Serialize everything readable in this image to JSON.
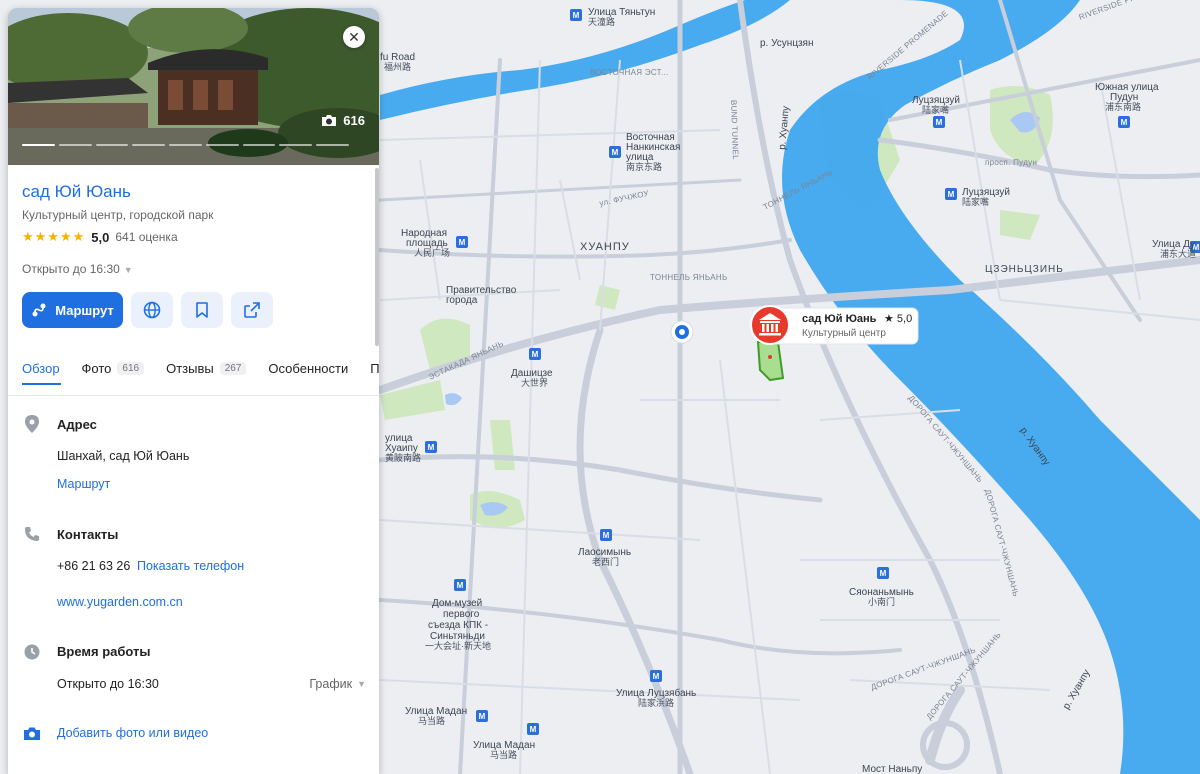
{
  "card": {
    "photo_count": "616",
    "title": "сад Юй Юань",
    "subtitle": "Культурный центр, городской парк",
    "stars": "★★★★★",
    "rating": "5,0",
    "rating_count": "641 оценка",
    "open_status": "Открыто до 16:30",
    "route_button": "Маршрут",
    "tabs": [
      {
        "label": "Обзор",
        "badge": ""
      },
      {
        "label": "Фото",
        "badge": "616"
      },
      {
        "label": "Отзывы",
        "badge": "267"
      },
      {
        "label": "Особенности",
        "badge": ""
      },
      {
        "label": "По",
        "badge": ""
      }
    ],
    "address_head": "Адрес",
    "address_value": "Шанхай, сад Юй Юань",
    "address_route_link": "Маршрут",
    "contacts_head": "Контакты",
    "phone_partial": "+86 21 63 26",
    "show_phone_link": "Показать телефон",
    "website": "www.yugarden.com.cn",
    "hours_head": "Время работы",
    "hours_value": "Открыто до 16:30",
    "schedule_link": "График",
    "add_photo_link": "Добавить фото или видео",
    "icons": [
      "camera-icon",
      "close-icon",
      "route-icon",
      "globe-icon",
      "bookmark-icon",
      "share-icon",
      "location-pin-icon",
      "phone-icon",
      "clock-icon",
      "camera-add-icon"
    ],
    "accent_color": "#1f6fe0"
  },
  "map": {
    "poi_popup": {
      "name": "сад Юй Юань",
      "rating": "★ 5,0",
      "category": "Культурный центр",
      "marker_color": "#e8392d"
    },
    "labels": {
      "tianton": "Улица Тяньтун",
      "tianton_cn": "天潼路",
      "fu_road": "fu Road",
      "fu_road_cn": "福州路",
      "east_nanking_1": "Восточная",
      "east_nanking_2": "Нанкинская",
      "east_nanking_3": "улица",
      "east_nanking_cn": "南京东路",
      "people_sq_1": "Народная",
      "people_sq_2": "площадь",
      "people_sq_cn": "人民广场",
      "gov_1": "Правительство",
      "gov_2": "города",
      "huangpu": "ХУАНПУ",
      "dashijie": "Дашицзе",
      "dashijie_cn": "大世界",
      "huaihai_1": "улица",
      "huaihai_2": "Хуаипу",
      "huaihai_cn": "黄陂南路",
      "laoximen": "Лаосимынь",
      "laoximen_cn": "老西门",
      "museum_1": "Дом-музей",
      "museum_2": "первого",
      "museum_3": "съезда КПК -",
      "museum_4": "Синьтяньди",
      "museum_cn": "一大会址·新天地",
      "lujiabang": "Улица Луцзябань",
      "lujiabang_cn": "陆家浜路",
      "madang1": "Улица Мадан",
      "madang1_cn": "马当路",
      "madang2": "Улица Мадан",
      "madang2_cn": "马当路",
      "xiaonanmen": "Сяонаньмынь",
      "xiaonanmen_cn": "小南门",
      "nanpu": "Мост Наньпу",
      "lujiazui": "Луцзяцзуй",
      "lujiazui_cn": "陆家嘴",
      "lujiazui2": "Луцзяцзуй",
      "lujiazui2_cn": "陆家嘴",
      "pudong_south_1": "Южная улица",
      "pudong_south_2": "Пудун",
      "pudong_south_cn": "浦东南路",
      "pudong_3": "Улица Ду",
      "pudong_3_cn": "浦东大道",
      "jinqiao": "ЦЗЭНЬЦЗИНЬ",
      "river_usun": "р. Усунцзян",
      "river_huangpu1": "р. Хуанпу",
      "river_huangpu2": "р. Хуанпу",
      "river_huangpu3": "р. Хуанпу",
      "riverside": "RIVERSIDE PROMENADE",
      "riverside2": "RIVERSIDE PROMENADE",
      "bund_tunnel": "BUND TUNNEL",
      "tunnel_yanan": "ТОННЕЛЬ ЯНЬАНЬ",
      "tunnel_yanan2": "ТОННЕЛЬ ЯНЬАНЬ",
      "estakada": "ЭСТАКАДА ЯНЬАНЬ",
      "pudong_prosp": "просп. Пудун",
      "fuchzhou": "ул. ФУЧЖОУ",
      "road_south": "ДОРОГА САУТ-ЧЖУНШАНЬ",
      "road_south2": "ДОРОГА САУТ-ЧЖУНШАНЬ",
      "road_south3": "ДОРОГА САУТ-ЧЖУНШАНЬ",
      "road_south4": "ДОРОГА САУТ-ЧЖУНШАНЬ",
      "east_road": "ВОСТОЧНАЯ ЭСТ...",
      "nanjing_road": "Нанкин"
    }
  }
}
